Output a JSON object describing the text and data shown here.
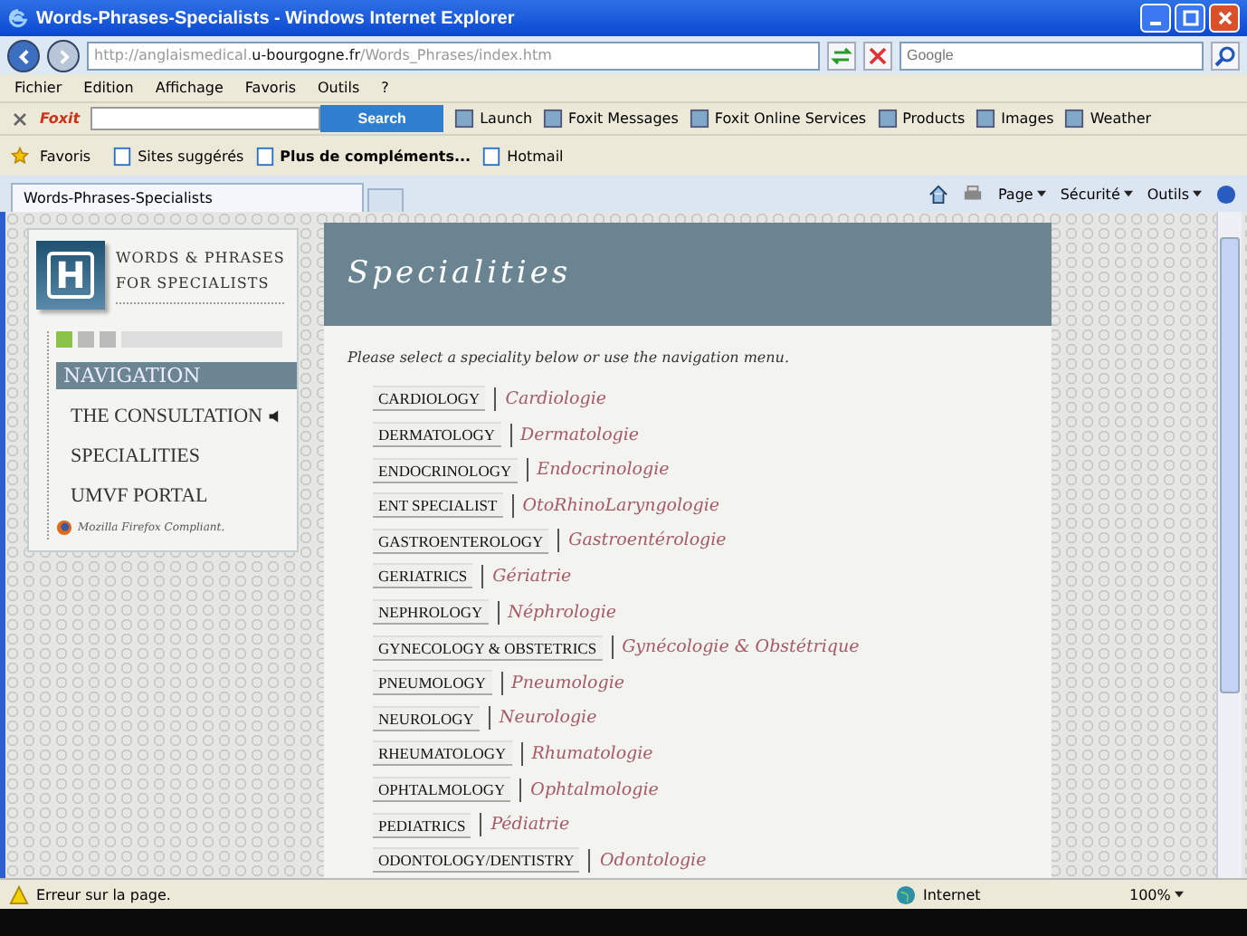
{
  "window": {
    "title": "Words-Phrases-Specialists - Windows Internet Explorer"
  },
  "address_bar": {
    "url_prefix": "http://anglaismedical.",
    "url_host": "u-bourgogne.fr",
    "url_path": "/Words_Phrases/index.htm"
  },
  "search_field": {
    "placeholder": "Google"
  },
  "menu": [
    "Fichier",
    "Edition",
    "Affichage",
    "Favoris",
    "Outils",
    "?"
  ],
  "foxit_toolbar": {
    "brand": "Foxit",
    "search_button": "Search",
    "items": [
      "Launch",
      "Foxit Messages",
      "Foxit Online Services",
      "Products",
      "Images",
      "Weather"
    ]
  },
  "favorites_bar": {
    "favorites": "Favoris",
    "items": [
      {
        "label": "Sites suggérés",
        "bold": false
      },
      {
        "label": "Plus de compléments...",
        "bold": true
      },
      {
        "label": "Hotmail",
        "bold": false
      }
    ]
  },
  "tabs": [
    {
      "label": "Words-Phrases-Specialists",
      "selected": true
    }
  ],
  "command_bar": [
    "Page",
    "Sécurité",
    "Outils"
  ],
  "sidebar": {
    "logo_letter": "H",
    "title_line1": "WORDS & PHRASES",
    "title_line2": "FOR SPECIALISTS",
    "nav_heading": "NAVIGATION",
    "items": [
      {
        "label": "THE CONSULTATION",
        "audio": true
      },
      {
        "label": "SPECIALITIES",
        "audio": false
      },
      {
        "label": "UMVF PORTAL",
        "audio": false
      }
    ],
    "footer": "Mozilla Firefox Compliant."
  },
  "main": {
    "heading": "Specialities",
    "intro": "Please select a speciality below or use the navigation menu.",
    "specialities": [
      {
        "en": "CARDIOLOGY",
        "fr": "Cardiologie"
      },
      {
        "en": "DERMATOLOGY",
        "fr": "Dermatologie"
      },
      {
        "en": "ENDOCRINOLOGY",
        "fr": "Endocrinologie"
      },
      {
        "en": "ENT SPECIALIST",
        "fr": "OtoRhinoLaryngologie"
      },
      {
        "en": "GASTROENTEROLOGY",
        "fr": "Gastroentérologie"
      },
      {
        "en": "GERIATRICS",
        "fr": "Gériatrie"
      },
      {
        "en": "NEPHROLOGY",
        "fr": "Néphrologie"
      },
      {
        "en": "GYNECOLOGY & OBSTETRICS",
        "fr": "Gynécologie & Obstétrique"
      },
      {
        "en": "PNEUMOLOGY",
        "fr": "Pneumologie"
      },
      {
        "en": "NEUROLOGY",
        "fr": "Neurologie"
      },
      {
        "en": "RHEUMATOLOGY",
        "fr": "Rhumatologie"
      },
      {
        "en": "OPHTALMOLOGY",
        "fr": "Ophtalmologie"
      },
      {
        "en": "PEDIATRICS",
        "fr": "Pédiatrie"
      },
      {
        "en": "ODONTOLOGY/DENTISTRY",
        "fr": "Odontologie"
      }
    ]
  },
  "status_bar": {
    "message": "Erreur sur la page.",
    "zone": "Internet",
    "zoom": "100%"
  }
}
